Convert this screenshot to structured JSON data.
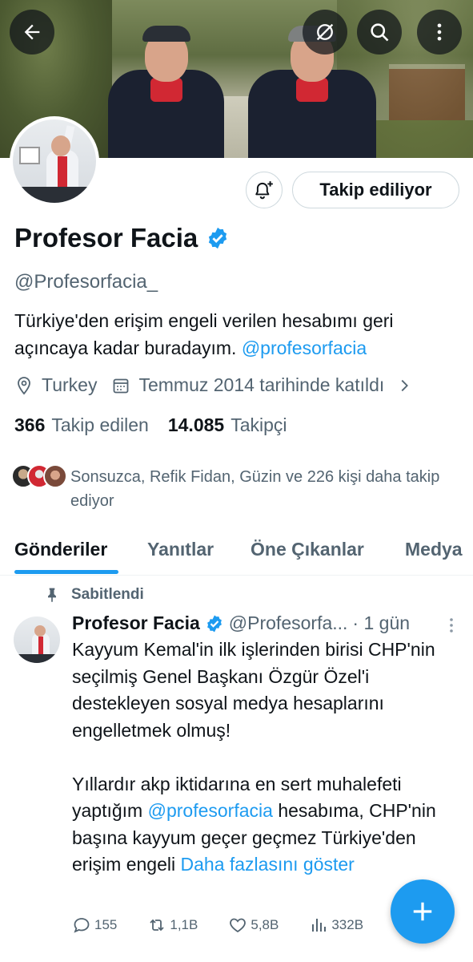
{
  "profile": {
    "name": "Profesor Facia",
    "handle": "@Profesorfacia_",
    "bio_text": "Türkiye'den erişim engeli verilen hesabımı geri açıncaya kadar buradayım.",
    "bio_link": "@profesorfacia",
    "location": "Turkey",
    "joined": "Temmuz 2014 tarihinde katıldı",
    "following_count": "366",
    "following_label": "Takip edilen",
    "followers_count": "14.085",
    "followers_label": "Takipçi",
    "followed_by": "Sonsuzca, Refik Fidan, Güzin ve 226 kişi daha takip ediyor"
  },
  "actions": {
    "follow_label": "Takip ediliyor"
  },
  "tabs": [
    {
      "label": "Gönderiler",
      "active": true
    },
    {
      "label": "Yanıtlar",
      "active": false
    },
    {
      "label": "Öne Çıkanlar",
      "active": false
    },
    {
      "label": "Medya",
      "active": false
    }
  ],
  "tweet": {
    "pinned_label": "Sabitlendi",
    "author_name": "Profesor Facia",
    "author_handle": "@Profesorfa...",
    "time": "· 1 gün",
    "text_p1": "Kayyum Kemal'in ilk işlerinden birisi CHP'nin seçilmiş Genel Başkanı Özgür Özel'i destekleyen sosyal medya hesaplarını engelletmek olmuş!",
    "text_p2_a": "Yıllardır akp iktidarına en sert muhalefeti yaptığım",
    "text_p2_link": "@profesorfacia",
    "text_p2_b": "hesabıma, CHP'nin başına kayyum geçer geçmez Türkiye'den erişim engeli",
    "show_more": "Daha fazlasını göster",
    "replies": "155",
    "retweets": "1,1B",
    "likes": "5,8B",
    "views": "332B"
  },
  "colors": {
    "accent": "#1d9bf0",
    "text": "#0f1419",
    "secondary": "#536471"
  }
}
